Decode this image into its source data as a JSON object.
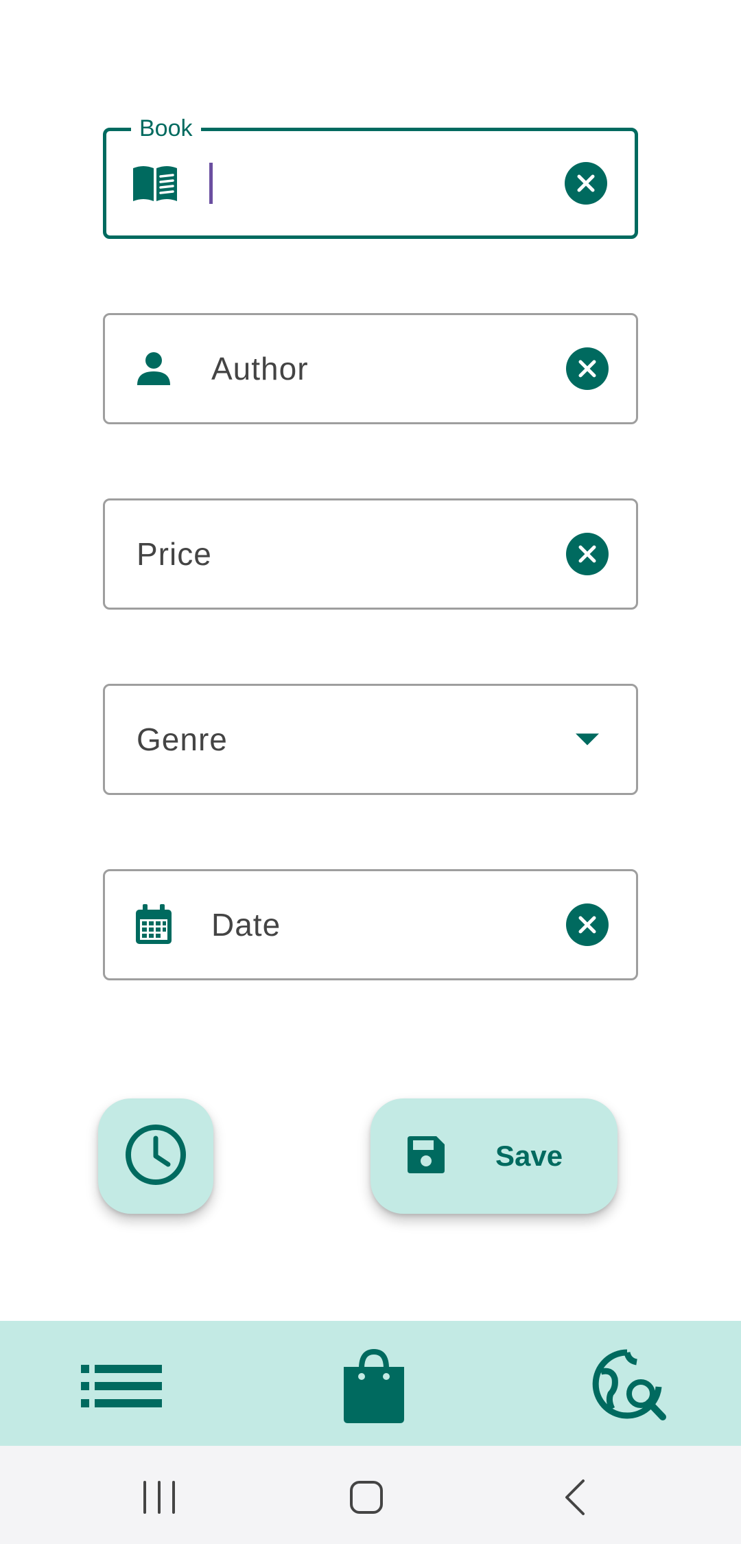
{
  "form": {
    "book": {
      "label": "Book",
      "value": ""
    },
    "author": {
      "placeholder": "Author"
    },
    "price": {
      "placeholder": "Price"
    },
    "genre": {
      "placeholder": "Genre"
    },
    "date": {
      "placeholder": "Date"
    }
  },
  "actions": {
    "save_label": "Save"
  },
  "icons": {
    "book": "book-open-icon",
    "author": "person-icon",
    "date": "calendar-icon",
    "clear": "clear-circle-icon",
    "dropdown": "arrow-drop-down-icon",
    "history": "clock-icon",
    "save": "floppy-disk-icon",
    "list": "list-icon",
    "shop": "shopping-bag-icon",
    "search": "travel-explore-icon"
  },
  "colors": {
    "accent": "#006a5f",
    "container": "#c3eae4",
    "cursor": "#6b4fa0"
  }
}
